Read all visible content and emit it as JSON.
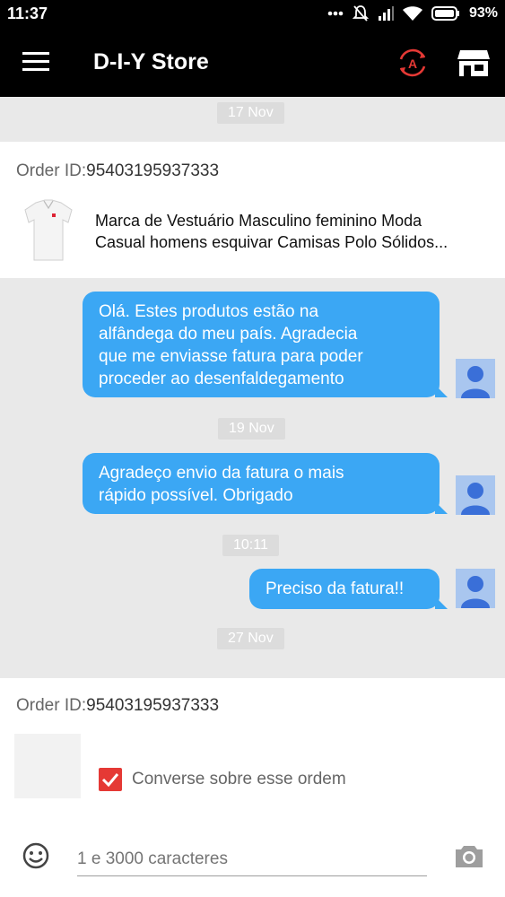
{
  "status_bar": {
    "time": "11:37",
    "battery": "93%"
  },
  "app_bar": {
    "title": "D-I-Y Store"
  },
  "dates": {
    "d1": "17 Nov",
    "d2": "19 Nov",
    "d3": "10:11",
    "d4": "27 Nov"
  },
  "order1": {
    "id_label": "Order ID:",
    "id_value": "95403195937333",
    "product_title_line1": "Marca de Vestuário Masculino feminino Moda",
    "product_title_line2": "Casual homens esquivar Camisas Polo Sólidos..."
  },
  "messages": [
    {
      "lines": [
        "Olá. Estes produtos estão na",
        "alfândega do meu país. Agradecia",
        "que me enviasse fatura para poder",
        "proceder ao desenfaldegamento"
      ]
    },
    {
      "lines": [
        "Agradeço envio da fatura o mais",
        "rápido possível. Obrigado"
      ]
    },
    {
      "lines": [
        "Preciso da fatura!!"
      ]
    }
  ],
  "order2": {
    "id_label": "Order ID:",
    "id_value": "95403195937333",
    "checkbox_label": "Converse sobre esse ordem"
  },
  "composer": {
    "placeholder": "1 e 3000 caracteres"
  },
  "colors": {
    "bubble": "#3ba7f4",
    "accent_red": "#e53935",
    "avatar_bg": "#a9c6ef",
    "avatar_fg": "#3a6fd8"
  }
}
